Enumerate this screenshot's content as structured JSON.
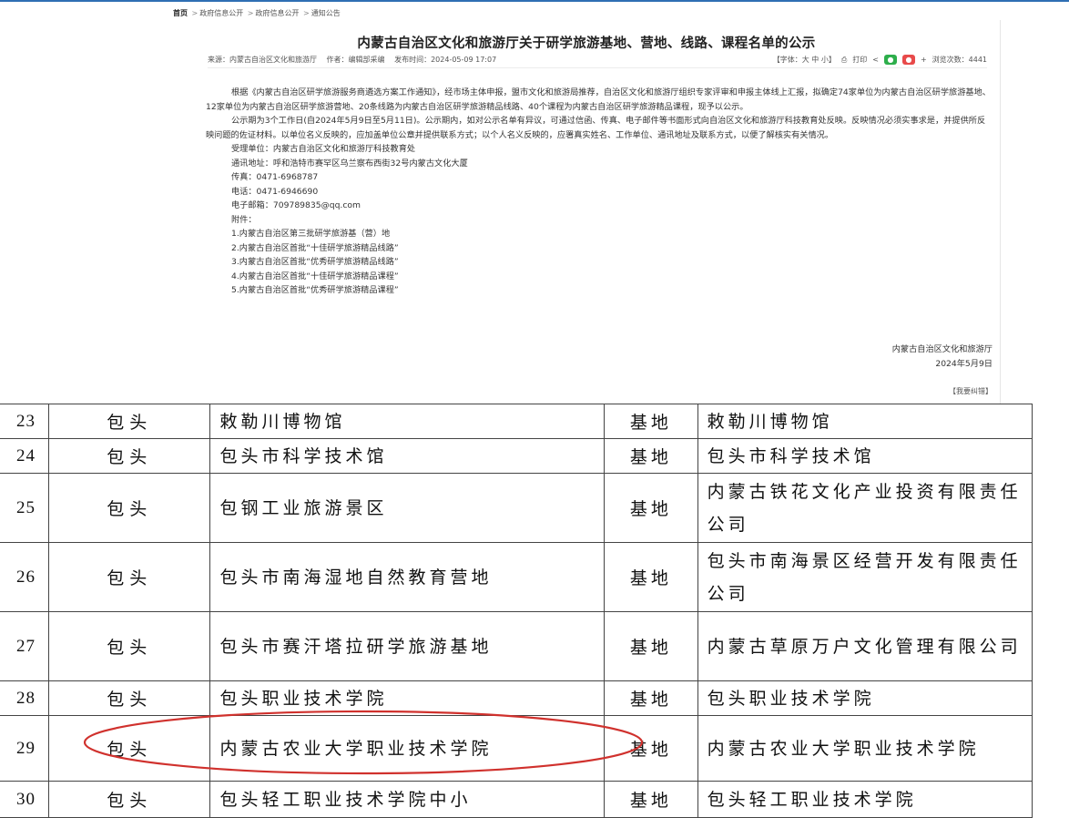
{
  "breadcrumb": {
    "home": "首页",
    "items": [
      "政府信息公开",
      "政府信息公开",
      "通知公告"
    ],
    "separator": ">"
  },
  "article": {
    "title": "内蒙古自治区文化和旅游厅关于研学旅游基地、营地、线路、课程名单的公示",
    "meta": {
      "source": "来源：内蒙古自治区文化和旅游厅",
      "author": "作者：编辑部采编",
      "published": "发布时间：2024-05-09 17:07",
      "font_size": "【字体：大 中 小】",
      "print": "打印",
      "plus": "+",
      "views": "浏览次数：4441"
    },
    "paragraphs": [
      "根据《内蒙古自治区研学旅游服务商遴选方案工作通知》，经市场主体申报，盟市文化和旅游局推荐，自治区文化和旅游厅组织专家评审和申报主体线上汇报，拟确定74家单位为内蒙古自治区研学旅游基地、12家单位为内蒙古自治区研学旅游营地、20条线路为内蒙古自治区研学旅游精品线路、40个课程为内蒙古自治区研学旅游精品课程，现予以公示。",
      "公示期为3个工作日(自2024年5月9日至5月11日)。公示期内，如对公示名单有异议，可通过信函、传真、电子邮件等书面形式向自治区文化和旅游厅科技教育处反映。反映情况必须实事求是，并提供所反映问题的佐证材料。以单位名义反映的，应加盖单位公章并提供联系方式；以个人名义反映的，应署真实姓名、工作单位、通讯地址及联系方式，以便了解核实有关情况。"
    ],
    "contacts": [
      "受理单位：内蒙古自治区文化和旅游厅科技教育处",
      "通讯地址：呼和浩特市赛罕区乌兰察布西街32号内蒙古文化大厦",
      "传真：0471-6968787",
      "电话：0471-6946690",
      "电子邮箱：709789835@qq.com",
      "附件："
    ],
    "attachments": [
      "1.内蒙古自治区第三批研学旅游基（营）地",
      "2.内蒙古自治区首批“十佳研学旅游精品线路”",
      "3.内蒙古自治区首批“优秀研学旅游精品线路”",
      "4.内蒙古自治区首批“十佳研学旅游精品课程”",
      "5.内蒙古自治区首批“优秀研学旅游精品课程”"
    ],
    "signature": {
      "org": "内蒙古自治区文化和旅游厅",
      "date": "2024年5月9日"
    },
    "correction": "【我要纠错】"
  },
  "table": {
    "rows": [
      {
        "num": "23",
        "city": "包头",
        "name": "敕勒川博物馆",
        "type": "基地",
        "org": "敕勒川博物馆"
      },
      {
        "num": "24",
        "city": "包头",
        "name": "包头市科学技术馆",
        "type": "基地",
        "org": "包头市科学技术馆"
      },
      {
        "num": "25",
        "city": "包头",
        "name": "包钢工业旅游景区",
        "type": "基地",
        "org": "内蒙古铁花文化产业投资有限责任公司"
      },
      {
        "num": "26",
        "city": "包头",
        "name": "包头市南海湿地自然教育营地",
        "type": "基地",
        "org": "包头市南海景区经营开发有限责任公司"
      },
      {
        "num": "27",
        "city": "包头",
        "name": "包头市赛汗塔拉研学旅游基地",
        "type": "基地",
        "org": "内蒙古草原万户文化管理有限公司"
      },
      {
        "num": "28",
        "city": "包头",
        "name": "包头职业技术学院",
        "type": "基地",
        "org": "包头职业技术学院"
      },
      {
        "num": "29",
        "city": "包头",
        "name": "内蒙古农业大学职业技术学院",
        "type": "基地",
        "org": "内蒙古农业大学职业技术学院"
      },
      {
        "num": "30",
        "city": "包头",
        "name": "包头轻工职业技术学院中小",
        "type": "基地",
        "org": "包头轻工职业技术学院"
      }
    ]
  },
  "annotation_color": "#d0312d"
}
